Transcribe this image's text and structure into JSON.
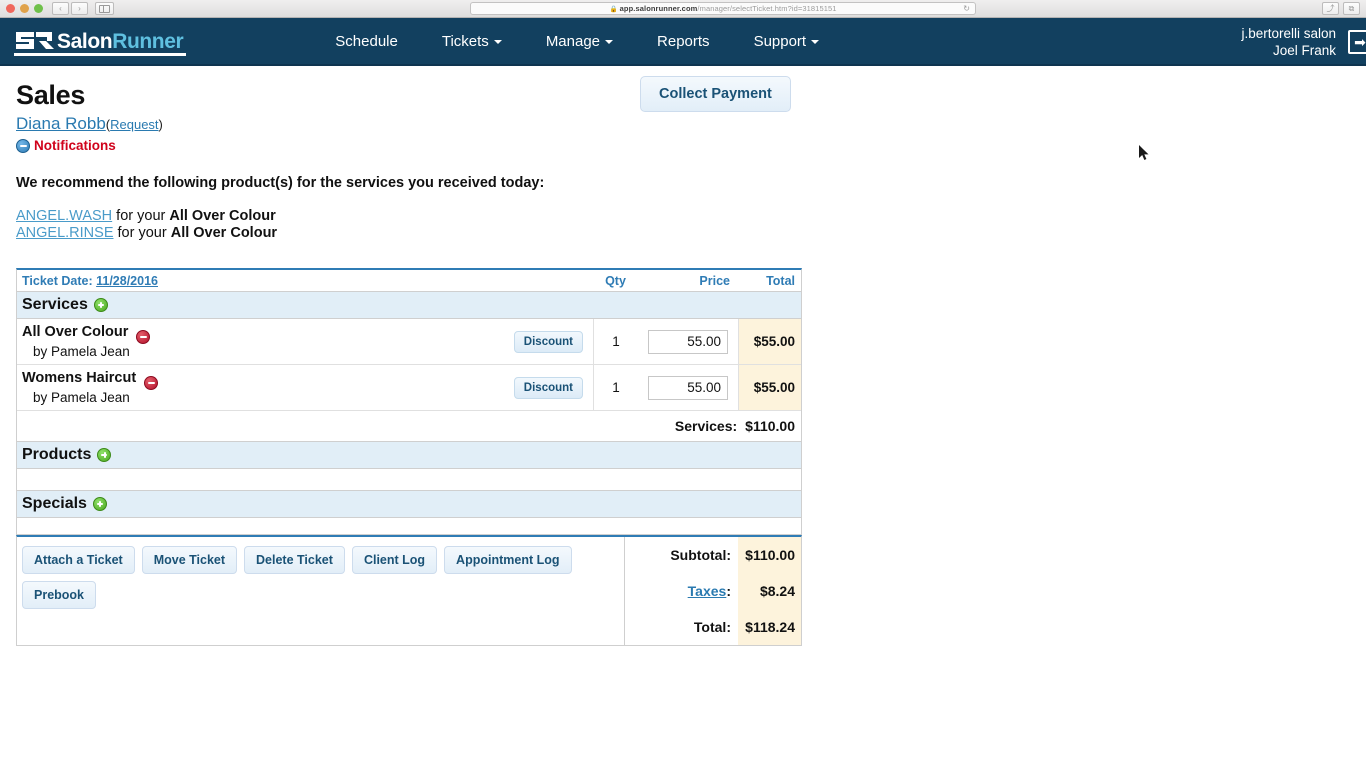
{
  "browser": {
    "url_lock": "\u0001",
    "url_host": "app.salonrunner.com",
    "url_path": "/manager/selectTicket.htm?id=31815151",
    "back_label": "‹",
    "forward_label": "›",
    "reload_label": "↻",
    "share_label": "⤴",
    "tabs_label": "⧉"
  },
  "nav": {
    "logo_salon": "Salon",
    "logo_runner": "Runner",
    "links": [
      {
        "label": "Schedule",
        "has_caret": false
      },
      {
        "label": "Tickets",
        "has_caret": true
      },
      {
        "label": "Manage",
        "has_caret": true
      },
      {
        "label": "Reports",
        "has_caret": false
      },
      {
        "label": "Support",
        "has_caret": true
      }
    ],
    "salon_name": "j.bertorelli salon",
    "user_name": "Joel Frank",
    "logout_glyph": "➡"
  },
  "page": {
    "title": "Sales",
    "collect_payment_label": "Collect Payment",
    "client_name": "Diana Robb",
    "paren_open": "(",
    "request_label": "Request",
    "paren_close": ")",
    "notifications_label": "Notifications",
    "recommend_text": "We recommend the following product(s) for the services you received today:",
    "recommendations": [
      {
        "product": "ANGEL.WASH",
        "connector": " for your ",
        "service": "All Over Colour"
      },
      {
        "product": "ANGEL.RINSE",
        "connector": " for your ",
        "service": "All Over Colour"
      }
    ]
  },
  "ticket": {
    "date_label": "Ticket Date: ",
    "date_value": "11/28/2016",
    "columns": {
      "qty": "Qty",
      "price": "Price",
      "total": "Total"
    },
    "sections": [
      {
        "title": "Services",
        "items": [
          {
            "name": "All Over Colour",
            "by": "by Pamela Jean",
            "discount_label": "Discount",
            "qty": "1",
            "price": "55.00",
            "total": "$55.00"
          },
          {
            "name": "Womens Haircut",
            "by": "by Pamela Jean",
            "discount_label": "Discount",
            "qty": "1",
            "price": "55.00",
            "total": "$55.00"
          }
        ],
        "subtotal_label": "Services:",
        "subtotal_value": "$110.00"
      },
      {
        "title": "Products",
        "items": [],
        "subtotal_label": "",
        "subtotal_value": ""
      },
      {
        "title": "Specials",
        "items": [],
        "subtotal_label": "",
        "subtotal_value": ""
      }
    ]
  },
  "footer": {
    "buttons": [
      "Attach a Ticket",
      "Move Ticket",
      "Delete Ticket",
      "Client Log",
      "Appointment Log",
      "Prebook"
    ],
    "totals": [
      {
        "label": "Subtotal:",
        "value": "$110.00",
        "link": false
      },
      {
        "label": "Taxes",
        "suffix": ":",
        "value": "$8.24",
        "link": true
      },
      {
        "label": "Total:",
        "value": "$118.24",
        "link": false
      }
    ]
  },
  "colors": {
    "nav_bg": "#12405f",
    "accent_blue": "#2f7cb5",
    "link_blue": "#2a7ab0",
    "notification_red": "#d0021b",
    "section_bg": "#e1eef7",
    "total_bg": "#fdf3dc",
    "logo_runner": "#5fc0e0"
  }
}
